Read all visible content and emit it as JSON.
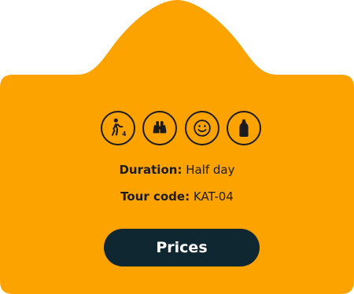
{
  "tour": {
    "duration_label": "Duration:",
    "duration_value": "Half day",
    "tour_code_label": "Tour code:",
    "tour_code_value": "KAT-04",
    "walk_level": "4",
    "prices_label": "Prices"
  },
  "icons": [
    "walking-difficulty-icon",
    "binoculars-icon",
    "smiley-face-icon",
    "water-bottle-icon"
  ],
  "colors": {
    "card_background": "#FDA300",
    "button_background": "#0F2730",
    "button_text": "#FFFFFF",
    "text": "#1B1B1B"
  }
}
